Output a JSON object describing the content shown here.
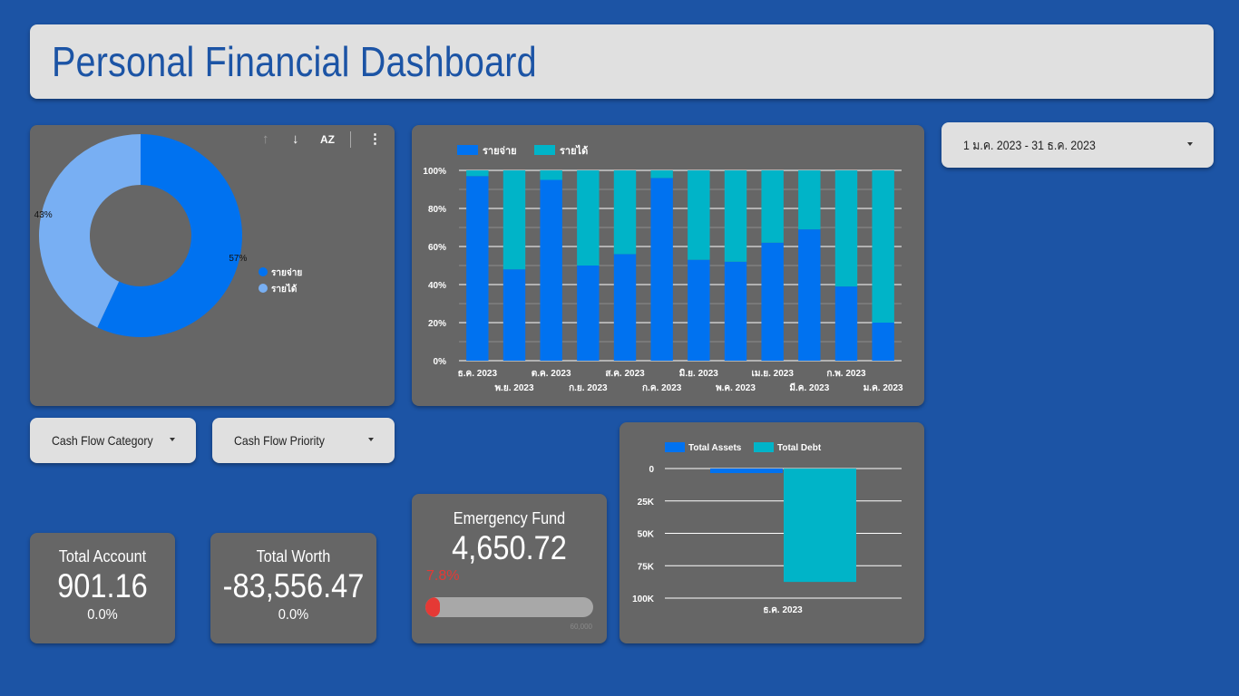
{
  "header": {
    "title": "Personal Financial Dashboard"
  },
  "colors": {
    "background": "#1c54a5",
    "card": "#666666",
    "control": "#e0e0e0",
    "expense": "#0072f0",
    "income_donut": "#78aff3",
    "income_bar": "#00b4c8",
    "alert": "#e53935"
  },
  "donut_toolbar": {
    "sort_up_icon": "arrow-up-icon",
    "sort_down_icon": "arrow-down-icon",
    "sort_az_icon": "sort-az-icon",
    "more_icon": "more-vert-icon",
    "az_label": "AZ"
  },
  "donut": {
    "chart_data": {
      "type": "pie",
      "labels": [
        "รายจ่าย",
        "รายได้"
      ],
      "values": [
        57,
        43
      ],
      "value_labels": [
        "57%",
        "43%"
      ],
      "colors": [
        "#0072f0",
        "#78aff3"
      ],
      "legend_position": "right"
    }
  },
  "stacked": {
    "chart_data": {
      "type": "bar",
      "stacked": "percent",
      "categories": [
        "ธ.ค. 2023",
        "พ.ย. 2023",
        "ต.ค. 2023",
        "ก.ย. 2023",
        "ส.ค. 2023",
        "ก.ค. 2023",
        "มิ.ย. 2023",
        "พ.ค. 2023",
        "เม.ย. 2023",
        "มี.ค. 2023",
        "ก.พ. 2023",
        "ม.ค. 2023"
      ],
      "series": [
        {
          "name": "รายจ่าย",
          "values": [
            97,
            48,
            95,
            50,
            56,
            96,
            53,
            52,
            62,
            69,
            39,
            20
          ],
          "color": "#0072f0"
        },
        {
          "name": "รายได้",
          "values": [
            3,
            52,
            5,
            50,
            44,
            4,
            47,
            48,
            38,
            31,
            61,
            80
          ],
          "color": "#00b4c8"
        }
      ],
      "yticks": [
        "100%",
        "80%",
        "60%",
        "40%",
        "20%",
        "0%"
      ],
      "ylim": [
        0,
        100
      ],
      "grid": true,
      "legend_position": "top-left"
    }
  },
  "date_range": {
    "value": "1 ม.ค. 2023 - 31 ธ.ค. 2023"
  },
  "filters": {
    "category_label": "Cash Flow Category",
    "priority_label": "Cash Flow Priority"
  },
  "kpis": {
    "total_account": {
      "title": "Total Account",
      "value": "901.16",
      "delta": "0.0%"
    },
    "total_worth": {
      "title": "Total Worth",
      "value": "-83,556.47",
      "delta": "0.0%"
    }
  },
  "emergency": {
    "title": "Emergency Fund",
    "value": "4,650.72",
    "percent_label": "7.8%",
    "progress": 0.078,
    "target_label": "60,000"
  },
  "assets_debt": {
    "chart_data": {
      "type": "bar",
      "categories": [
        "ธ.ค. 2023"
      ],
      "series": [
        {
          "name": "Total Assets",
          "values": [
            -3500
          ],
          "color": "#0072f0"
        },
        {
          "name": "Total Debt",
          "values": [
            -87500
          ],
          "color": "#00b4c8"
        }
      ],
      "yticks": [
        "0",
        "25K",
        "50K",
        "75K",
        "100K"
      ],
      "ylim": [
        0,
        -100000
      ],
      "grid": true,
      "legend_position": "top-left"
    }
  }
}
